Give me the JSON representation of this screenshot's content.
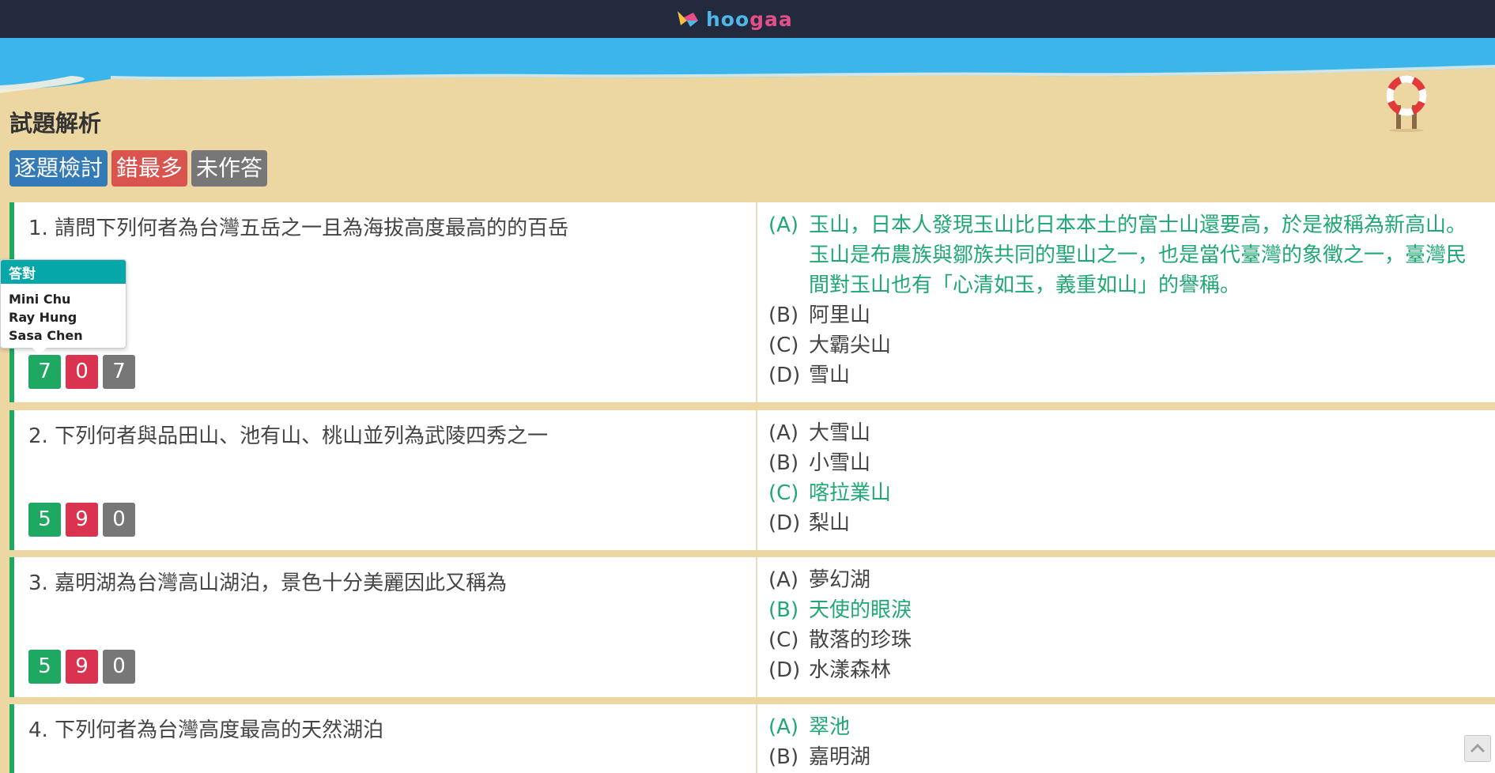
{
  "brand": {
    "logo_text_a": "hoo",
    "logo_text_b": "gaa"
  },
  "page": {
    "section_title": "試題解析"
  },
  "filters": [
    {
      "label": "逐題檢討",
      "color": "#337ab7"
    },
    {
      "label": "錯最多",
      "color": "#d9534f"
    },
    {
      "label": "未作答",
      "color": "#777777"
    }
  ],
  "popover": {
    "title": "答對",
    "names": [
      "Mini Chu",
      "Ray Hung",
      "Sasa Chen"
    ]
  },
  "questions": [
    {
      "text": "1. 請問下列何者為台灣五岳之一且為海拔高度最高的的百岳",
      "stats": {
        "correct": "7",
        "wrong": "0",
        "unanswered": "7"
      },
      "options": [
        {
          "letter": "(A)",
          "text": "玉山，日本人發現玉山比日本本土的富士山還要高，於是被稱為新高山。玉山是布農族與鄒族共同的聖山之一，也是當代臺灣的象徵之一，臺灣民間對玉山也有「心清如玉，義重如山」的譽稱。",
          "correct": true
        },
        {
          "letter": "(B)",
          "text": "阿里山",
          "correct": false
        },
        {
          "letter": "(C)",
          "text": "大霸尖山",
          "correct": false
        },
        {
          "letter": "(D)",
          "text": "雪山",
          "correct": false
        }
      ]
    },
    {
      "text": "2. 下列何者與品田山、池有山、桃山並列為武陵四秀之一",
      "stats": {
        "correct": "5",
        "wrong": "9",
        "unanswered": "0"
      },
      "options": [
        {
          "letter": "(A)",
          "text": "大雪山",
          "correct": false
        },
        {
          "letter": "(B)",
          "text": "小雪山",
          "correct": false
        },
        {
          "letter": "(C)",
          "text": "喀拉業山",
          "correct": true
        },
        {
          "letter": "(D)",
          "text": "梨山",
          "correct": false
        }
      ]
    },
    {
      "text": "3. 嘉明湖為台灣高山湖泊，景色十分美麗因此又稱為",
      "stats": {
        "correct": "5",
        "wrong": "9",
        "unanswered": "0"
      },
      "options": [
        {
          "letter": "(A)",
          "text": "夢幻湖",
          "correct": false
        },
        {
          "letter": "(B)",
          "text": "天使的眼淚",
          "correct": true
        },
        {
          "letter": "(C)",
          "text": "散落的珍珠",
          "correct": false
        },
        {
          "letter": "(D)",
          "text": "水漾森林",
          "correct": false
        }
      ]
    },
    {
      "text": "4. 下列何者為台灣高度最高的天然湖泊",
      "options": [
        {
          "letter": "(A)",
          "text": "翠池",
          "correct": true
        },
        {
          "letter": "(B)",
          "text": "嘉明湖",
          "correct": false
        }
      ]
    }
  ],
  "colors": {
    "correct_text": "#1fa872",
    "correct_stat": "#1fa862",
    "wrong_stat": "#d9334f",
    "unanswered_stat": "#777777",
    "topbar": "#242a3d",
    "sand": "#ecd6a2",
    "sky": "#3cb6ea",
    "popover_header": "#06a7a8"
  },
  "icons": {
    "logo": "hoogaa-bird-logo",
    "lifebuoy": "lifebuoy-icon",
    "scroll_top": "chevron-up-icon"
  }
}
